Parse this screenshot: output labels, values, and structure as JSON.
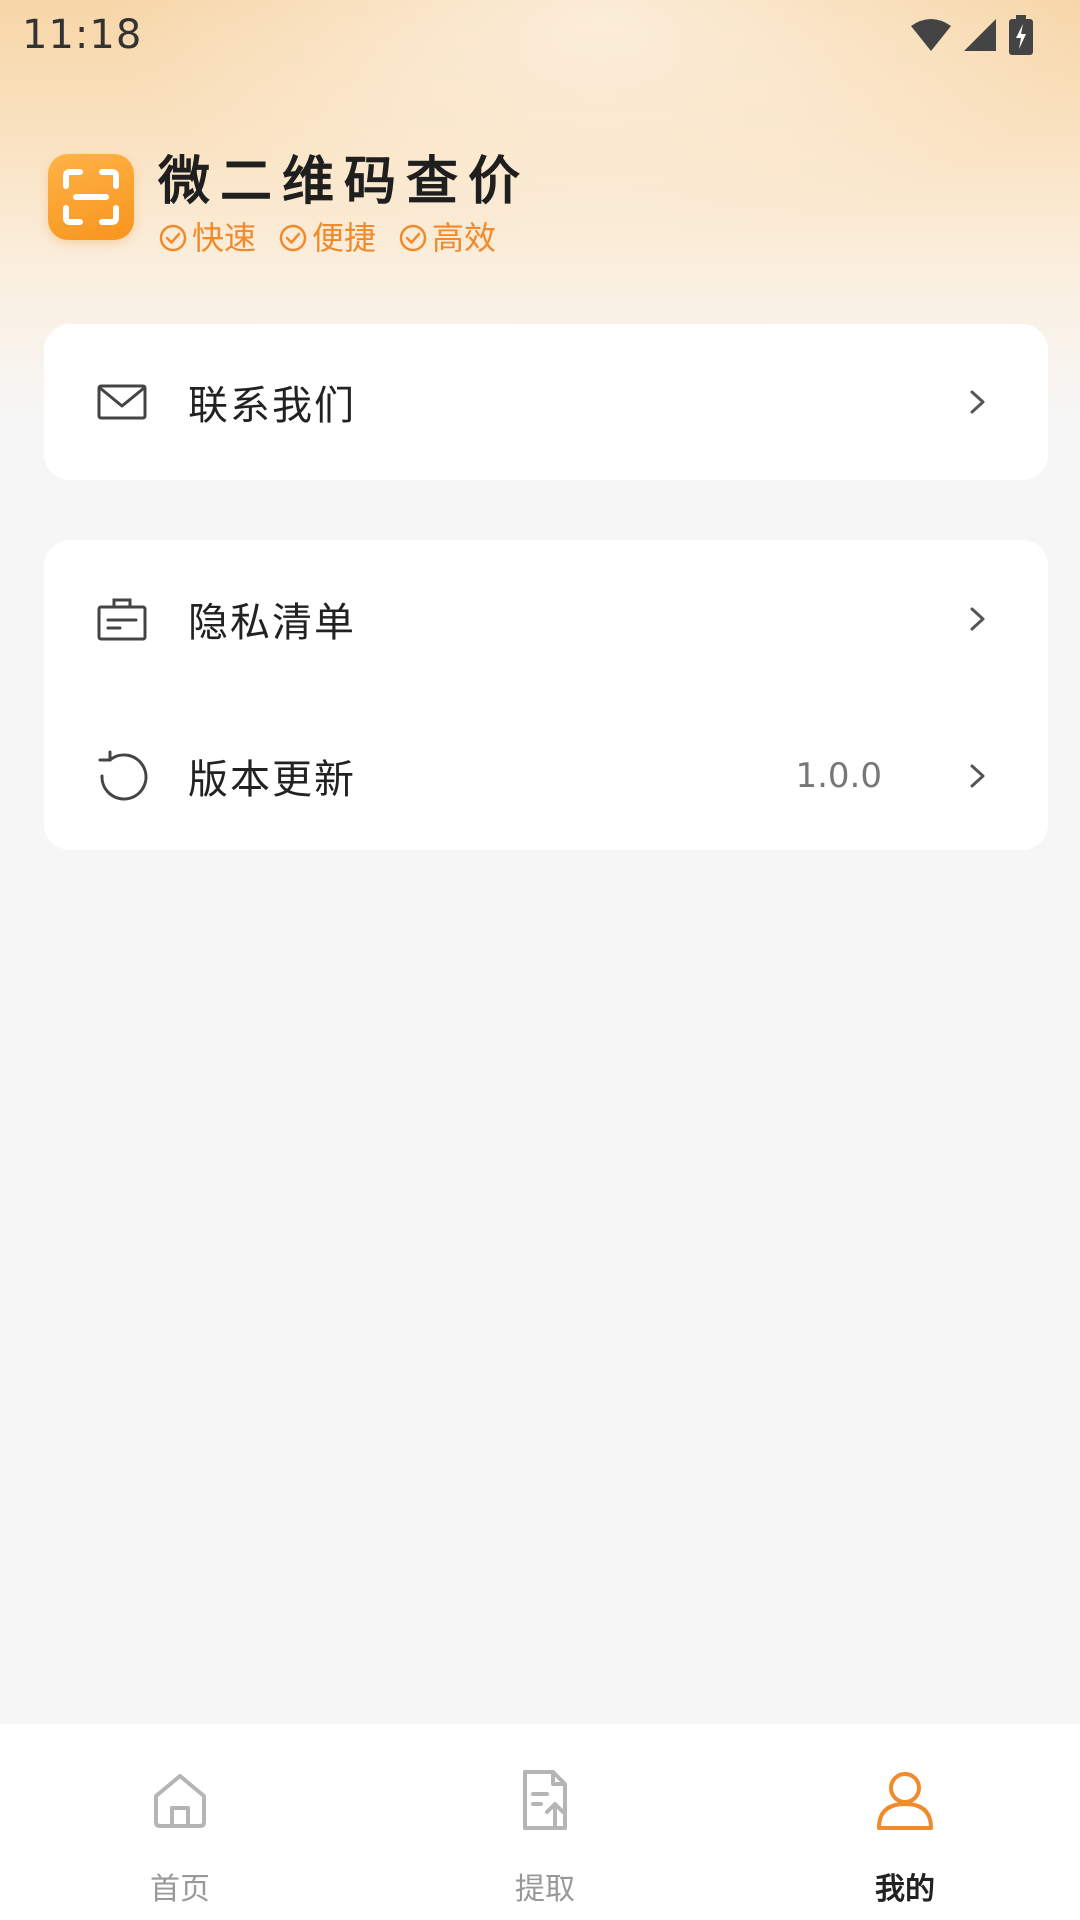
{
  "status_bar": {
    "time": "11:18"
  },
  "header": {
    "app_name": "微二维码查价",
    "tags": [
      "快速",
      "便捷",
      "高效"
    ]
  },
  "menu": {
    "contact": {
      "label": "联系我们",
      "icon": "mail-icon"
    },
    "privacy": {
      "label": "隐私清单",
      "icon": "list-icon"
    },
    "update": {
      "label": "版本更新",
      "value": "1.0.0",
      "icon": "refresh-icon"
    }
  },
  "tabbar": {
    "items": [
      {
        "label": "首页",
        "icon": "home-icon",
        "active": false
      },
      {
        "label": "提取",
        "icon": "document-upload-icon",
        "active": false
      },
      {
        "label": "我的",
        "icon": "user-icon",
        "active": true
      }
    ]
  },
  "colors": {
    "accent": "#f08a2a",
    "background": "#f6f6f6"
  }
}
